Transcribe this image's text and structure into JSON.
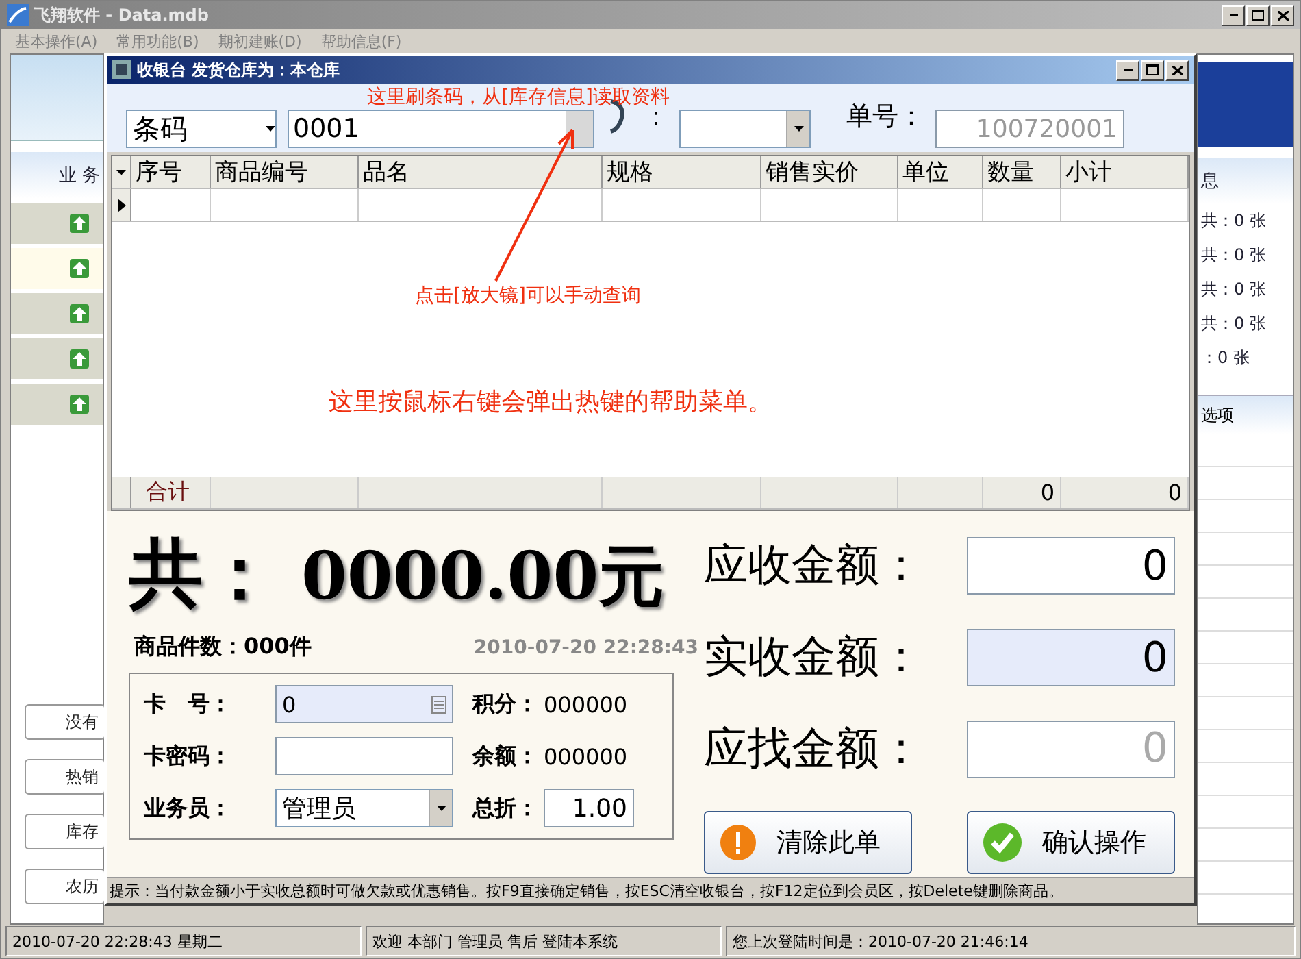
{
  "window": {
    "title": "飞翔软件 - Data.mdb"
  },
  "menu": [
    "基本操作(A)",
    "常用功能(B)",
    "期初建账(D)",
    "帮助信息(F)"
  ],
  "left_panel": {
    "header": "业 务",
    "rows": [
      {
        "highlighted": false
      },
      {
        "highlighted": true
      },
      {
        "highlighted": false
      },
      {
        "highlighted": false
      },
      {
        "highlighted": false
      }
    ],
    "buttons": [
      "没有",
      "热销",
      "库存",
      "农历"
    ]
  },
  "right_panel": {
    "header": "息",
    "lines": [
      "共：0 张",
      "共：0 张",
      "共：0 张",
      "共：0 张",
      "：0 张"
    ],
    "options_header": "选项"
  },
  "dialog": {
    "title": "收银台 发货仓库为：本仓库",
    "toolbar": {
      "search_type": "条码",
      "barcode": "0001",
      "member_label": "：",
      "order_label": "单号：",
      "order_number": "100720001"
    },
    "table": {
      "columns": [
        "序号",
        "商品编号",
        "品名",
        "规格",
        "销售实价",
        "单位",
        "数量",
        "小计"
      ],
      "rows": [
        {
          "current": true
        }
      ],
      "footer": {
        "label": "合计",
        "quantity": "0",
        "subtotal": "0"
      }
    },
    "annotations": [
      {
        "kind": "small",
        "text": "这里刷条码，从[库存信息]读取资料"
      },
      {
        "kind": "small",
        "text": "点击[放大镜]可以手动查询"
      },
      {
        "kind": "large",
        "text": "这里按鼠标右键会弹出热键的帮助菜单。"
      }
    ],
    "total": {
      "label": "共：",
      "value": "0000.00元"
    },
    "item_count": "商品件数：000件",
    "datetime": "2010-07-20 22:28:43",
    "member": {
      "card_label": "卡　号：",
      "card_value": "0",
      "password_label": "卡密码：",
      "clerk_label": "业务员：",
      "clerk_value": "管理员",
      "points_label": "积分：",
      "points_value": "000000",
      "balance_label": "余额：",
      "balance_value": "000000",
      "discount_label": "总折：",
      "discount_value": "1.00"
    },
    "amounts": [
      {
        "label": "应收金额：",
        "value": "0",
        "focused": false,
        "disabled": false
      },
      {
        "label": "实收金额：",
        "value": "0",
        "focused": true,
        "disabled": false
      },
      {
        "label": "应找金额：",
        "value": "0",
        "focused": false,
        "disabled": true
      }
    ],
    "buttons": [
      {
        "kind": "clear",
        "label": "清除此单"
      },
      {
        "kind": "confirm",
        "label": "确认操作"
      }
    ],
    "hint": "提示：当付款金额小于实收总额时可做欠款或优惠销售。按F9直接确定销售，按ESC清空收银台，按F12定位到会员区，按Delete键删除商品。"
  },
  "status_bar": [
    "2010-07-20 22:28:43  星期二",
    "欢迎 本部门 管理员 售后 登陆本系统",
    "您上次登陆时间是：2010-07-20 21:46:14"
  ]
}
